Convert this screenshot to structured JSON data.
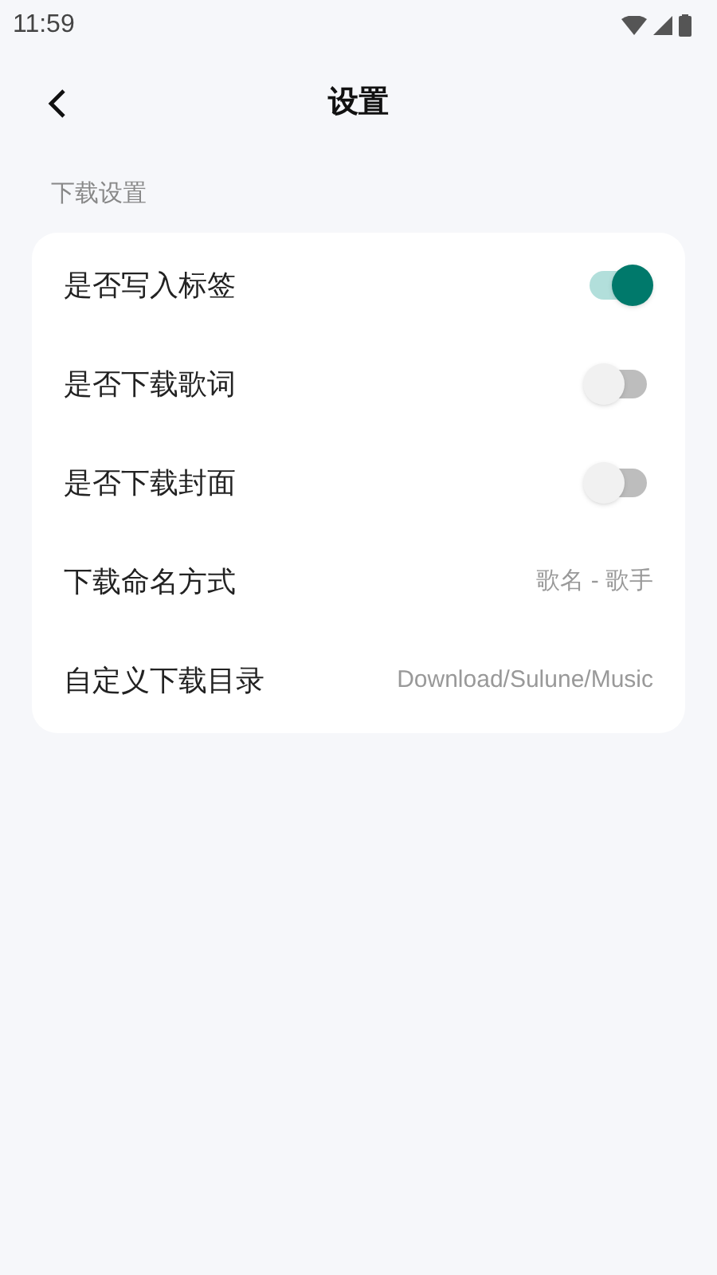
{
  "status_bar": {
    "time": "11:59"
  },
  "header": {
    "title": "设置"
  },
  "section": {
    "title": "下载设置"
  },
  "rows": [
    {
      "kind": "switch",
      "label": "是否写入标签",
      "on": true
    },
    {
      "kind": "switch",
      "label": "是否下载歌词",
      "on": false
    },
    {
      "kind": "switch",
      "label": "是否下载封面",
      "on": false
    },
    {
      "kind": "value",
      "label": "下载命名方式",
      "value": "歌名 - 歌手"
    },
    {
      "kind": "value",
      "label": "自定义下载目录",
      "value": "Download/Sulune/Music"
    }
  ]
}
